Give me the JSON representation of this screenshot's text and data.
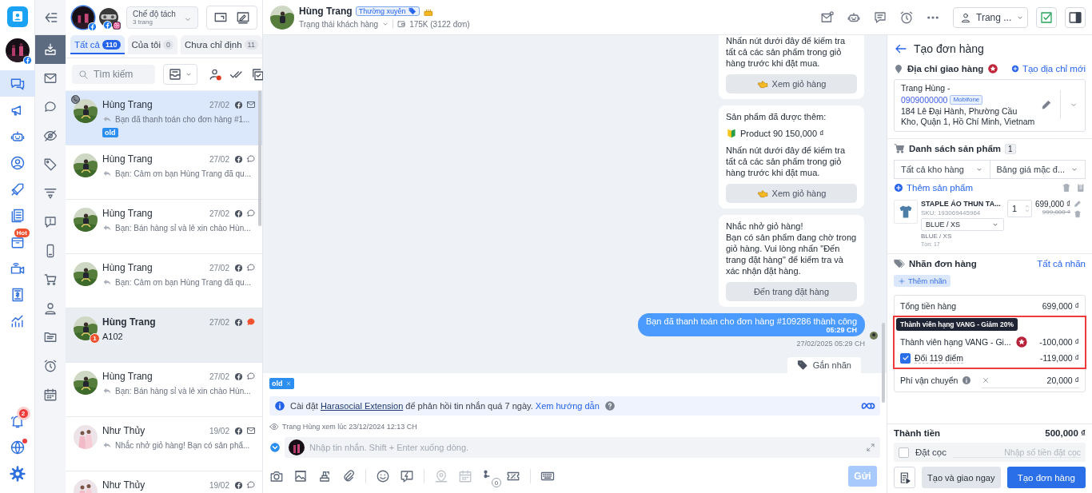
{
  "nav_main": [
    {
      "selected": true
    },
    {
      "selected": false
    },
    {
      "selected": false
    },
    {
      "selected": false
    },
    {
      "selected": false
    },
    {
      "selected": false
    },
    {
      "selected": false,
      "badge": "Hot"
    },
    {
      "selected": false
    },
    {
      "selected": false
    },
    {
      "selected": false
    }
  ],
  "nav_bottom": {
    "notification_count": "2",
    "globe_alert": true
  },
  "nav_filters": [
    {
      "selected": true
    },
    {
      "selected": false
    },
    {
      "selected": false
    },
    {
      "selected": false
    },
    {
      "selected": false
    },
    {
      "selected": false
    },
    {
      "selected": false
    },
    {
      "selected": false
    },
    {
      "selected": false
    },
    {
      "selected": false
    },
    {
      "selected": false
    },
    {
      "selected": false
    },
    {
      "selected": false
    }
  ],
  "page_switcher": {
    "mode": "Chế độ tách",
    "pages": "3 trang"
  },
  "tabs": [
    {
      "label": "Tất cả",
      "count": "110",
      "selected": true
    },
    {
      "label": "Của tôi",
      "count": "0",
      "selected": false
    },
    {
      "label": "Chưa chỉ định",
      "count": "11",
      "selected": false
    }
  ],
  "search": {
    "placeholder": "Tìm kiếm"
  },
  "conversations": [
    {
      "name": "Hùng Trang",
      "date": "27/02",
      "channel": {
        "kind": "mail"
      },
      "replied": true,
      "preview": "Bạn đã thanh toán cho đơn hàng #1...",
      "tag": "old",
      "avatar": {
        "kind": "outdoor"
      },
      "call": true,
      "unread": false,
      "selected": true
    },
    {
      "name": "Hùng Trang",
      "date": "27/02",
      "channel": {
        "kind": "comment"
      },
      "replied": true,
      "preview": "Bạn: Cảm ơn bạn Hùng Trang đã qu...",
      "avatar": {
        "kind": "outdoor"
      },
      "call": false,
      "unread": false,
      "selected": false
    },
    {
      "name": "Hùng Trang",
      "date": "27/02",
      "channel": {
        "kind": "comment"
      },
      "replied": true,
      "preview": "Bạn: Bán hàng sỉ và lẻ xin chào Hùn...",
      "avatar": {
        "kind": "outdoor"
      },
      "call": false,
      "unread": false,
      "selected": false
    },
    {
      "name": "Hùng Trang",
      "date": "27/02",
      "channel": {
        "kind": "comment"
      },
      "replied": true,
      "preview": "Bạn: Cảm ơn bạn Hùng Trang đã qu...",
      "avatar": {
        "kind": "outdoor"
      },
      "call": false,
      "unread": false,
      "selected": false
    },
    {
      "name": "Hùng Trang",
      "date": "27/02",
      "channel": {
        "kind": "comment"
      },
      "replied": false,
      "preview": "A102",
      "avatar": {
        "kind": "outdoor"
      },
      "call": false,
      "unread": true,
      "unread_count": "1",
      "selected": false
    },
    {
      "name": "Hùng Trang",
      "date": "27/02",
      "channel": {
        "kind": "comment"
      },
      "replied": true,
      "preview": "Bạn: Bán hàng sỉ và lẻ xin chào Hùn...",
      "avatar": {
        "kind": "outdoor"
      },
      "call": false,
      "unread": false,
      "selected": false
    },
    {
      "name": "Như Thủy",
      "date": "19/02",
      "channel": {
        "kind": "mail"
      },
      "replied": true,
      "preview": "Nhắc nhở giỏ hàng! Bạn có sản phẩ...",
      "avatar": {
        "kind": "portrait"
      },
      "call": false,
      "unread": false,
      "selected": false
    },
    {
      "name": "Như Thủy",
      "date": "19/02",
      "channel": {
        "kind": "comment"
      },
      "avatar": {
        "kind": "portrait"
      },
      "call": false,
      "unread": false,
      "selected": false
    }
  ],
  "chat_header": {
    "name": "Hùng Trang",
    "tag": "Thường xuyên",
    "status": "Trạng thái khách hàng",
    "stats": "175K (3122 đơn)",
    "assignee": "Trang ..."
  },
  "messages": [
    {
      "kind": "bot",
      "cut": true,
      "paragraphs": [
        {
          "kind": "text",
          "text": "Nhấn nút dưới đây để kiểm tra tất cả các sản phẩm trong giỏ hàng trước khi đặt mua."
        }
      ],
      "button": {
        "label": "Xem giỏ hàng",
        "kind": "view_cart"
      }
    },
    {
      "kind": "bot",
      "cut": false,
      "paragraphs": [
        {
          "kind": "text",
          "text": "Sản phẩm đã được thêm:"
        },
        {
          "kind": "product",
          "text": "Product 90 150,000 ₫"
        },
        {
          "kind": "text",
          "text": "Nhấn nút dưới đây để kiểm tra tất cả các sản phẩm trong giỏ hàng trước khi đặt mua."
        }
      ],
      "button": {
        "label": "Xem giỏ hàng",
        "kind": "view_cart"
      }
    },
    {
      "kind": "bot",
      "cut": false,
      "paragraphs": [
        {
          "kind": "text",
          "text": "Nhắc nhở giỏ hàng!\nBạn có sản phẩm đang chờ trong giỏ hàng. Vui lòng nhấn \"Đến trang đặt hàng\" để kiểm tra và xác nhận đặt hàng."
        }
      ],
      "button": {
        "label": "Đến trang đặt hàng",
        "kind": "checkout"
      }
    },
    {
      "kind": "sent",
      "text": "Bạn đã thanh toán cho đơn hàng #109286 thành công",
      "time": "05:29 CH",
      "stamp": "27/02/2025 05:29 CH"
    }
  ],
  "label_button": "Gắn nhãn",
  "composer": {
    "tags": [
      "old"
    ],
    "notice": {
      "before": "Cài đặt",
      "link": "Harasocial Extension",
      "after": "để phản hồi tin nhắn quá 7 ngày.",
      "help": "Xem hướng dẫn"
    },
    "seen": "Trang Hùng xem lúc 23/12/2024 12:13 CH",
    "placeholder": "Nhập tin nhắn. Shift + Enter xuống dòng.",
    "flow_count": "0",
    "send": {
      "label": "Gửi",
      "disabled": true
    }
  },
  "order": {
    "title": "Tạo đơn hàng",
    "address": {
      "label": "Địa chỉ giao hàng",
      "new_link": "Tạo địa chỉ mới",
      "name": "Trang Hùng -",
      "phone": "0909000000",
      "carrier": "Mobifone",
      "line": "184 Lê Đại Hành, Phường Cầu Kho, Quận 1, Hồ Chí Minh, Vietnam"
    },
    "products": {
      "label": "Danh sách sản phẩm",
      "count": "1",
      "warehouse": "Tất cả kho hàng",
      "price_list": "Bảng giá mặc đ...",
      "add": "Thêm sản phẩm",
      "items": [
        {
          "name": "STAPLE ÁO THUN TA...",
          "sku": "SKU: 193069445964",
          "variant_select": "BLUE / XS",
          "variant": "BLUE / XS",
          "stock": "Tồn: 17",
          "quantity": "1",
          "price": "699,000 ₫",
          "old_price": "999,000 ₫"
        }
      ]
    },
    "labels": {
      "label": "Nhãn đơn hàng",
      "all": "Tất cả nhãn",
      "add": "Thêm nhãn"
    },
    "summary": {
      "subtotal_label": "Tổng tiền hàng",
      "subtotal": "699,000 ₫",
      "highlighted": true,
      "tooltip": "Thành viên hạng VANG - Giảm 20%",
      "discount_label": "Thành viên hạng VANG - Gi...",
      "discount": "-100,000 ₫",
      "points": {
        "label": "Đổi 119 điểm",
        "checked": true,
        "amount": "-119,000 ₫"
      },
      "shipping_label": "Phí vận chuyển",
      "shipping": "20,000 ₫"
    },
    "total_label": "Thành tiền",
    "total": "500,000 ₫",
    "deposit": {
      "label": "Đặt cọc",
      "checked": false,
      "placeholder": "Nhập số tiền đặt cọc"
    },
    "buttons": {
      "secondary": "Tạo và giao ngay",
      "primary": "Tạo đơn hàng"
    }
  }
}
